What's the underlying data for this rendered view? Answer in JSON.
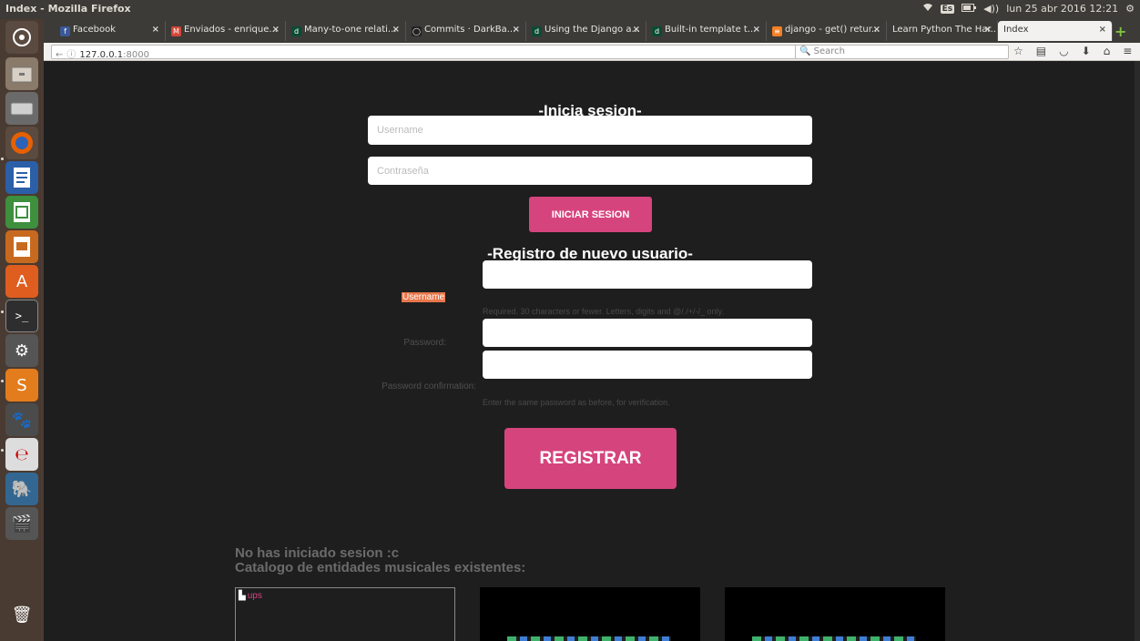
{
  "system": {
    "window_title": "Index - Mozilla Firefox",
    "keyboard": "Es",
    "datetime": "lun 25 abr 2016 12:21"
  },
  "tabs": [
    {
      "label": "Facebook",
      "icon": "facebook-icon",
      "color": "#3b5998",
      "glyph": "f"
    },
    {
      "label": "Enviados - enrique...",
      "icon": "gmail-icon",
      "color": "#d44638",
      "glyph": "M"
    },
    {
      "label": "Many-to-one relati...",
      "icon": "django-icon",
      "color": "#0c4b33",
      "glyph": "dj"
    },
    {
      "label": "Commits · DarkBa...",
      "icon": "github-icon",
      "color": "#222222",
      "glyph": "◯"
    },
    {
      "label": "Using the Django a...",
      "icon": "django-icon",
      "color": "#0c4b33",
      "glyph": "dj"
    },
    {
      "label": "Built-in template t...",
      "icon": "django-icon",
      "color": "#0c4b33",
      "glyph": "dj"
    },
    {
      "label": "django - get() retur...",
      "icon": "stackoverflow-icon",
      "color": "#f48024",
      "glyph": "≡"
    },
    {
      "label": "Learn Python The Har...",
      "icon": "",
      "color": "",
      "glyph": ""
    },
    {
      "label": "Index",
      "icon": "",
      "color": "",
      "glyph": "",
      "active": true
    }
  ],
  "navbar": {
    "url_host": "127.0.0.1",
    "url_port": ":8000",
    "search_placeholder": "Search"
  },
  "login": {
    "title": "-Inicia sesion-",
    "username_placeholder": "Username",
    "password_placeholder": "Contraseña",
    "submit_label": "INICIAR SESION"
  },
  "register": {
    "title": "-Registro de nuevo usuario-",
    "username_label": "Username",
    "username_hint": "Required. 30 characters or fewer. Letters, digits and @/./+/-/_ only.",
    "password_label": "Password:",
    "confirm_label": "Password confirmation:",
    "confirm_hint": "Enter the same password as before, for verification.",
    "submit_label": "REGISTRAR"
  },
  "status": {
    "line1": "No has iniciado sesion :c",
    "line2": "Catalogo de entidades musicales existentes:"
  },
  "catalog": {
    "broken_image_alt": "ups"
  },
  "colors": {
    "accent": "#d6447e",
    "highlight": "#e8764a"
  }
}
